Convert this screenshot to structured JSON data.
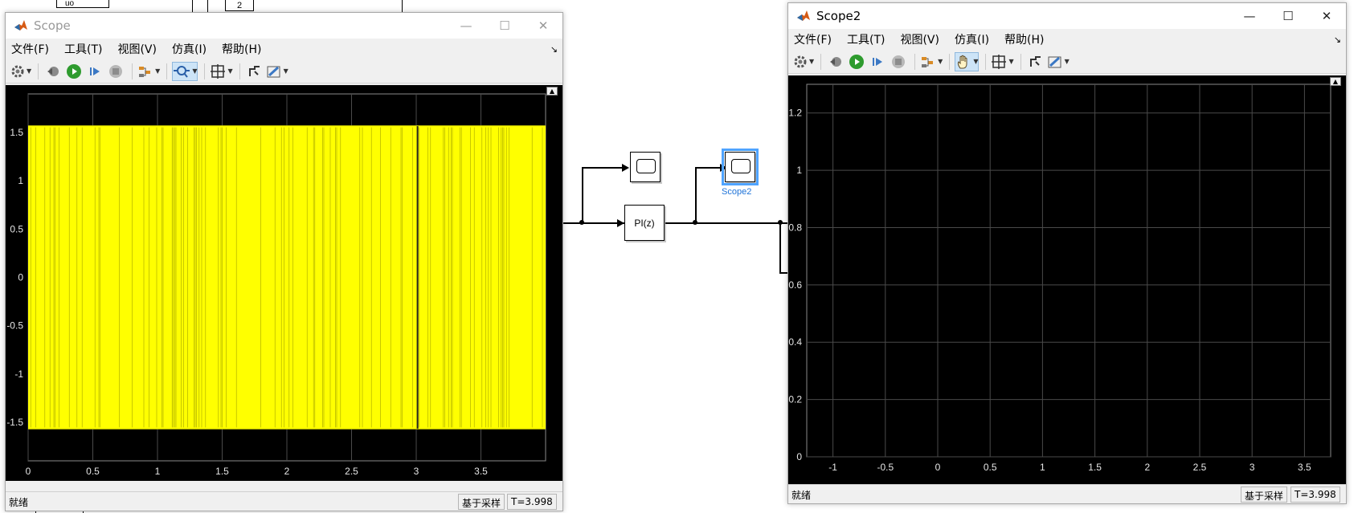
{
  "model": {
    "top_label_1": "uo",
    "top_label_2": "2",
    "pi_block_label": "PI(z)",
    "scope2_caption": "Scope2"
  },
  "scope1": {
    "title": "Scope",
    "menu": [
      "文件(F)",
      "工具(T)",
      "视图(V)",
      "仿真(I)",
      "帮助(H)"
    ],
    "status": "就绪",
    "sample_mode": "基于采样",
    "time": "T=3.998",
    "chart_data": {
      "type": "line",
      "x_ticks": [
        "0",
        "0.5",
        "1",
        "1.5",
        "2",
        "2.5",
        "3",
        "3.5"
      ],
      "y_ticks": [
        "1.5",
        "1",
        "0.5",
        "0",
        "-0.5",
        "-1",
        "-1.5"
      ],
      "xlim": [
        0,
        4
      ],
      "ylim": [
        -1.9,
        1.9
      ],
      "series": [
        {
          "color": "#ffff00",
          "min": -1.57,
          "max": 1.57,
          "t_start": 0,
          "t_end": 4
        }
      ],
      "grid": true
    }
  },
  "scope2": {
    "title": "Scope2",
    "menu": [
      "文件(F)",
      "工具(T)",
      "视图(V)",
      "仿真(I)",
      "帮助(H)"
    ],
    "status": "就绪",
    "sample_mode": "基于采样",
    "time": "T=3.998",
    "chart_data": {
      "type": "line",
      "x_ticks": [
        "-1",
        "-0.5",
        "0",
        "0.5",
        "1",
        "1.5",
        "2",
        "2.5",
        "3",
        "3.5"
      ],
      "y_ticks": [
        "1.2",
        "1",
        "0.8",
        "0.6",
        "0.4",
        "0.2",
        "0"
      ],
      "xlim": [
        -1.25,
        3.75
      ],
      "ylim": [
        0,
        1.3
      ],
      "series": [],
      "grid": true
    }
  }
}
